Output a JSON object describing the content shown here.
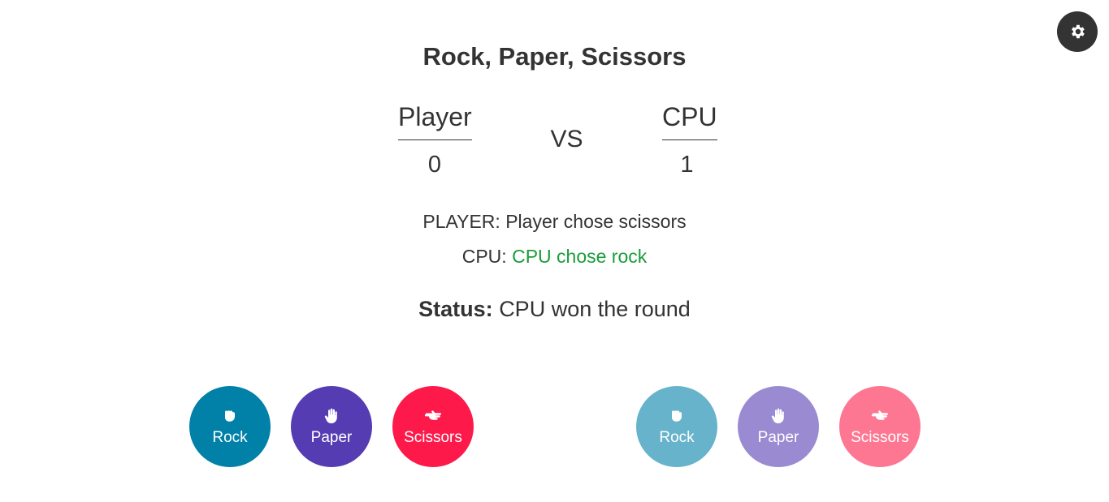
{
  "title": "Rock, Paper, Scissors",
  "settings": {
    "icon": "gear-icon"
  },
  "scoreboard": {
    "player_label": "Player",
    "player_score": "0",
    "vs_label": "VS",
    "cpu_label": "CPU",
    "cpu_score": "1"
  },
  "choices": {
    "player_prefix": "PLAYER:",
    "player_text": "Player chose scissors",
    "cpu_prefix": "CPU:",
    "cpu_text": "CPU chose rock",
    "cpu_text_color": "#1a9c3a"
  },
  "status": {
    "label": "Status:",
    "text": "CPU won the round"
  },
  "player_buttons": [
    {
      "label": "Rock",
      "icon": "fist-icon",
      "color": "#0180a8"
    },
    {
      "label": "Paper",
      "icon": "hand-icon",
      "color": "#553cb3"
    },
    {
      "label": "Scissors",
      "icon": "scissors-hand-icon",
      "color": "#fd1a4b"
    }
  ],
  "cpu_buttons": [
    {
      "label": "Rock",
      "icon": "fist-icon",
      "color": "#67b3cb"
    },
    {
      "label": "Paper",
      "icon": "hand-icon",
      "color": "#998ad1"
    },
    {
      "label": "Scissors",
      "icon": "scissors-hand-icon",
      "color": "#fd7792"
    }
  ]
}
